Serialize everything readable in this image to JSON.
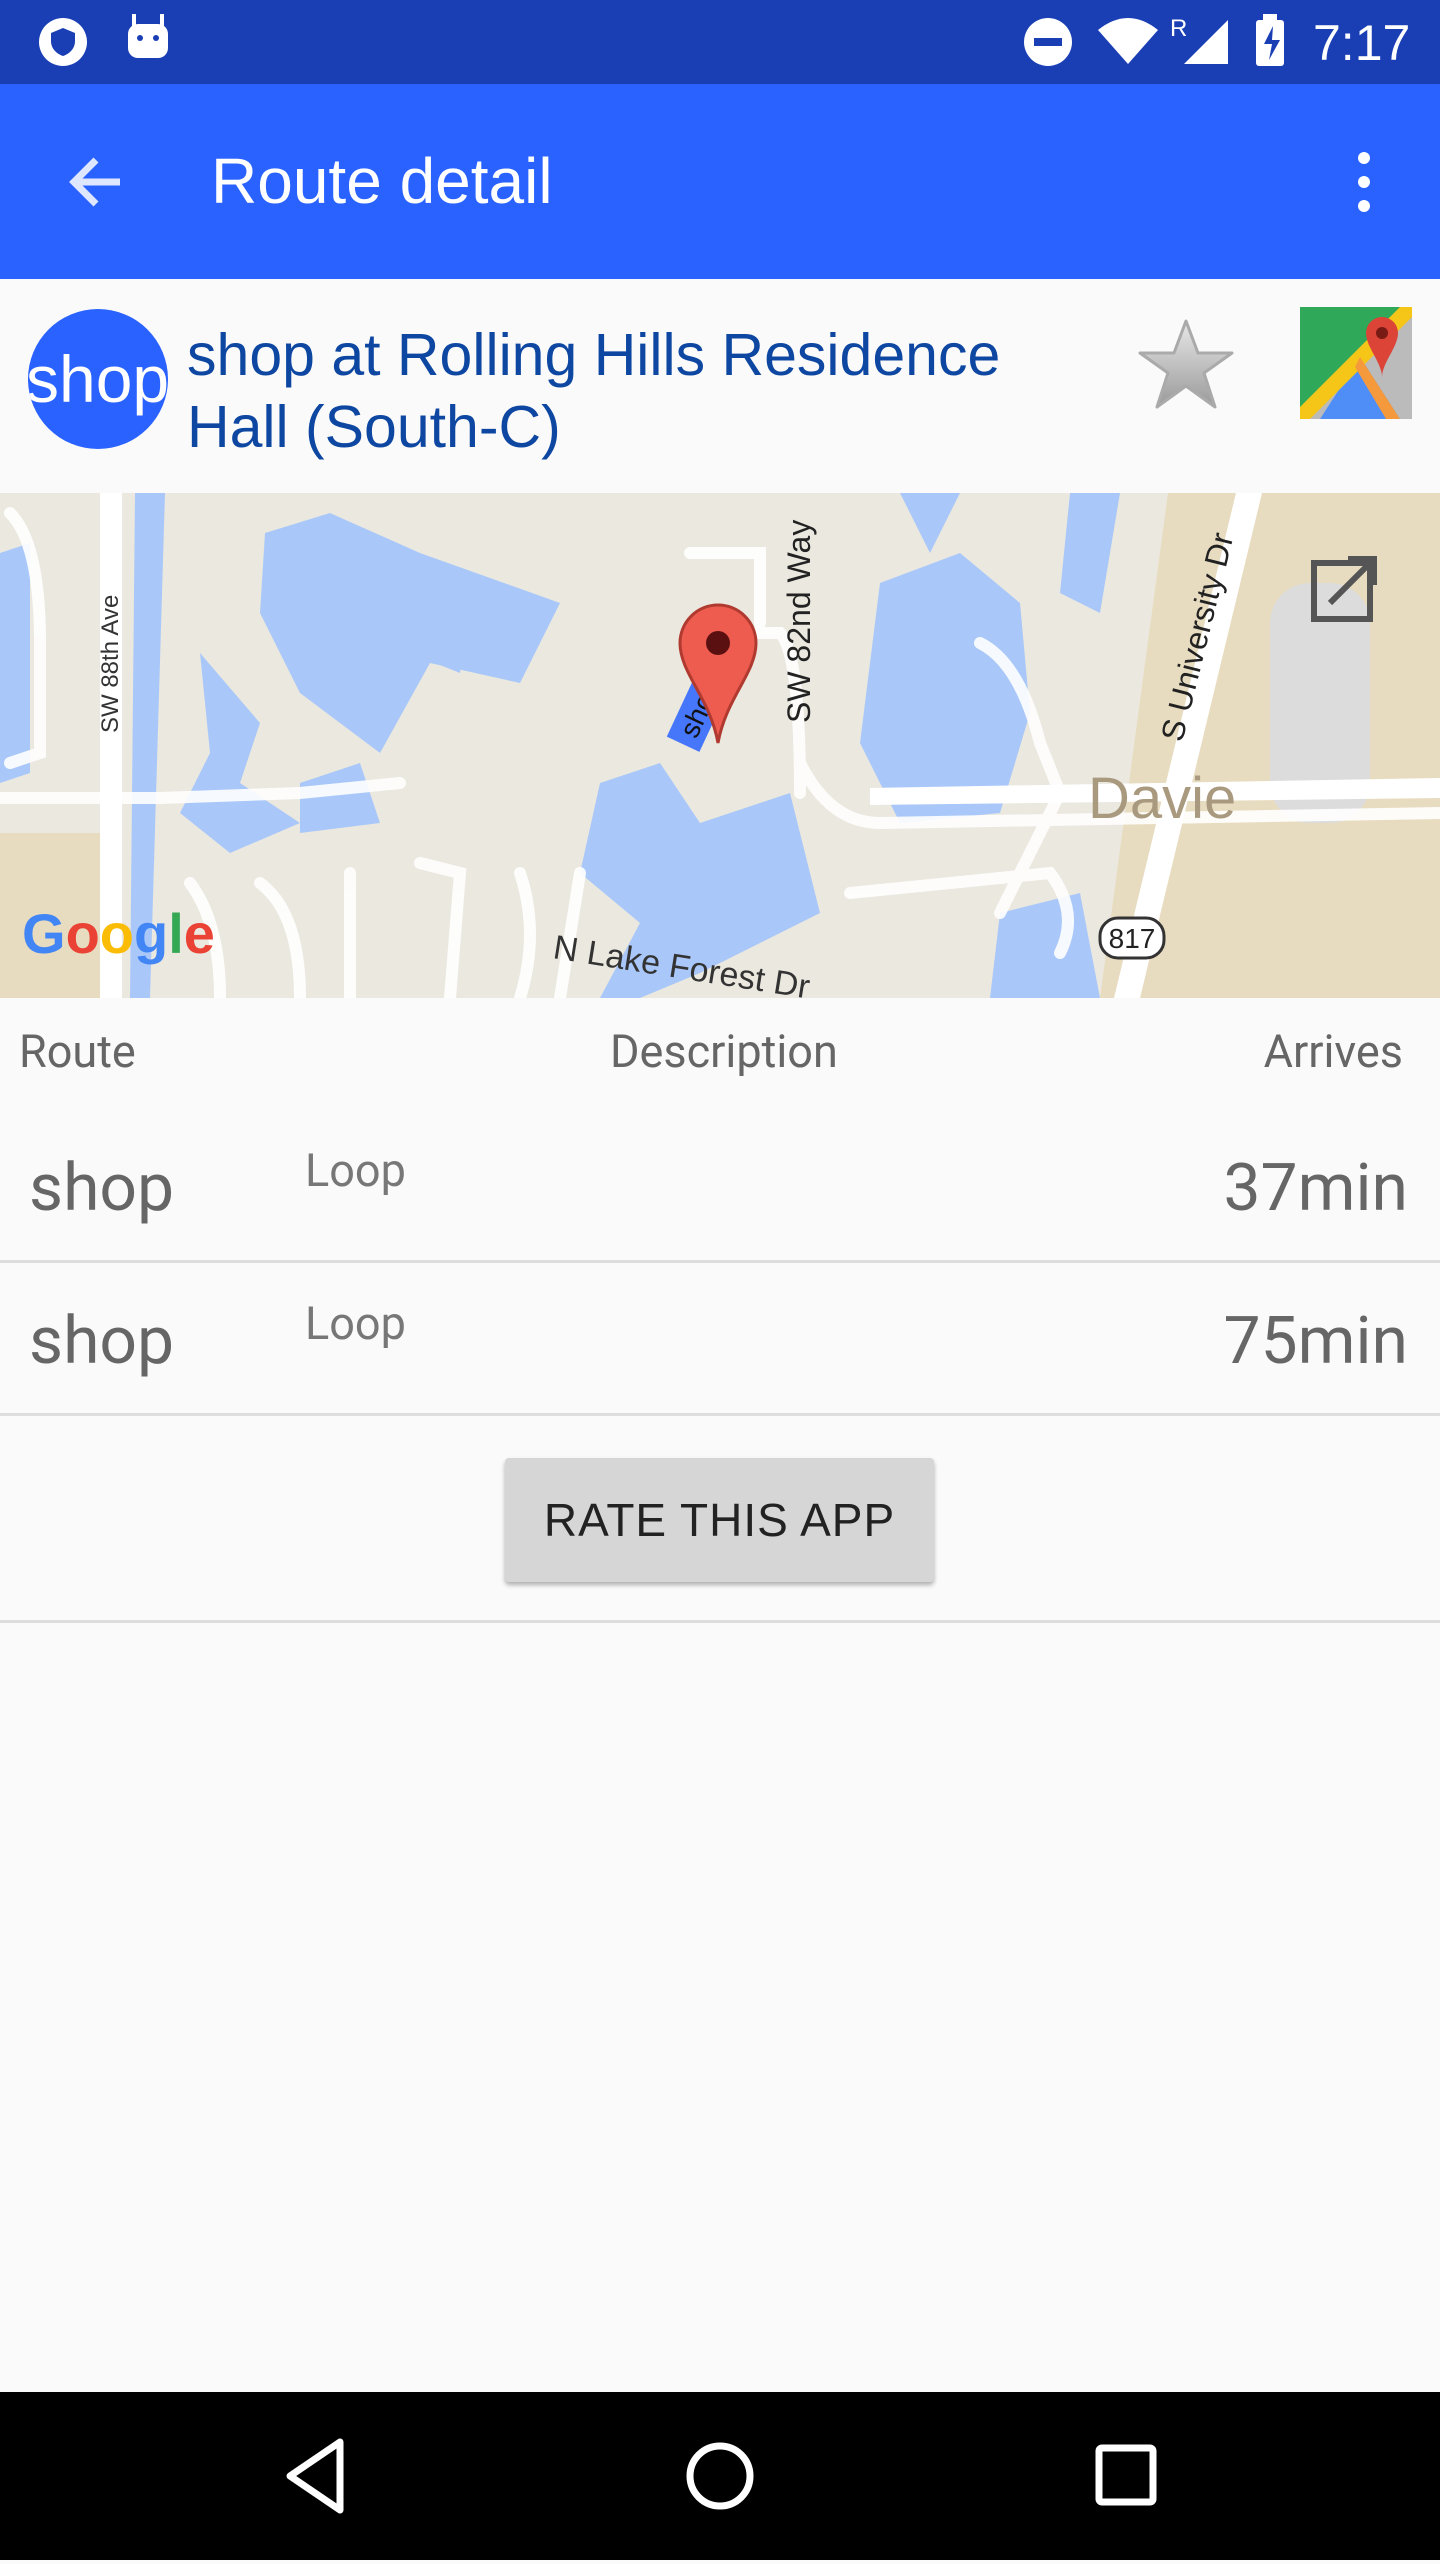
{
  "status_bar": {
    "time": "7:17",
    "roaming": "R",
    "icons": [
      "vpn-shield-icon",
      "android-icon",
      "do-not-disturb-icon",
      "wifi-icon",
      "signal-icon",
      "battery-charging-icon"
    ]
  },
  "app_bar": {
    "title": "Route detail",
    "back_icon": "arrow-back-icon",
    "menu_icon": "more-vert-icon"
  },
  "stop": {
    "avatar_text": "shop",
    "title": "shop at Rolling Hills Residence Hall (South-C)",
    "favorite_icon": "star-icon",
    "maps_icon": "google-maps-icon"
  },
  "map": {
    "labels": {
      "sw88": "SW 88th Ave",
      "sw82": "SW 82nd Way",
      "univ": "S University Dr",
      "davie": "Davie",
      "lake": "N Lake Forest Dr",
      "shield": "817",
      "marker_label": "shop"
    },
    "logo": "Google",
    "open_icon": "open-in-new-icon"
  },
  "table": {
    "headers": {
      "route": "Route",
      "description": "Description",
      "arrives": "Arrives"
    },
    "rows": [
      {
        "route": "shop",
        "description": "Loop",
        "arrives": "37min"
      },
      {
        "route": "shop",
        "description": "Loop",
        "arrives": "75min"
      }
    ]
  },
  "rate_button": "RATE THIS APP",
  "colors": {
    "app_bar": "#2962ff",
    "status_bar": "#1a3fb5",
    "title": "#0d47a1"
  }
}
